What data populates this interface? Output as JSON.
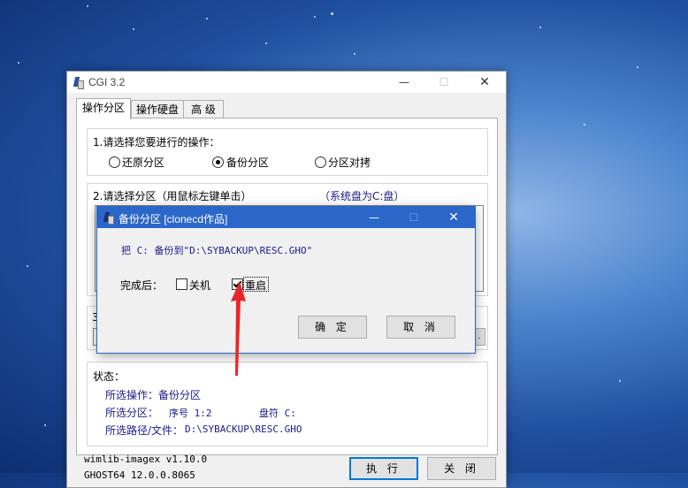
{
  "main_window": {
    "title": "CGI 3.2",
    "controls": {
      "minimize": "—",
      "maximize": "☐",
      "close": "✕"
    },
    "tabs": [
      {
        "label": "操作分区",
        "active": true
      },
      {
        "label": "操作硬盘",
        "active": false
      },
      {
        "label": "高 级",
        "active": false
      }
    ],
    "operation_group": {
      "prompt": "1.请选择您要进行的操作：",
      "options": [
        {
          "label": "还原分区",
          "checked": false
        },
        {
          "label": "备份分区",
          "checked": true
        },
        {
          "label": "分区对拷",
          "checked": false
        }
      ]
    },
    "partition_group": {
      "prompt": "2.请选择分区（用鼠标左键单击）",
      "hint": "（系统盘为C:盘）"
    },
    "step3_prefix": "3",
    "status": {
      "heading": "状态：",
      "line1_label": "所选操作：",
      "line1_value": "备份分区",
      "line2_label": "所选分区：",
      "line2_no": "序号 1:2",
      "line2_drive": "盘符 C:",
      "line3_label": "所选路径/文件：",
      "line3_value": "D:\\SYBACKUP\\RESC.GHO"
    },
    "footer_line1": "wimlib-imagex v1.10.0",
    "footer_line2": "GHOST64 12.0.0.8065",
    "execute_label": "执 行",
    "close_label": "关 闭"
  },
  "dialog": {
    "title": "备份分区 [clonecd作品]",
    "controls": {
      "minimize": "—",
      "maximize": "☐",
      "close": "✕"
    },
    "message": "把 C: 备份到\"D:\\SYBACKUP\\RESC.GHO\"",
    "after_label": "完成后：",
    "shutdown_label": "关机",
    "shutdown_checked": false,
    "restart_label": "重启",
    "restart_checked": true,
    "ok_label": "确 定",
    "cancel_label": "取 消"
  },
  "colors": {
    "dialog_titlebar": "#2b67c9",
    "annotation_arrow": "#e8262a",
    "blue_text": "#1a1a8c"
  }
}
